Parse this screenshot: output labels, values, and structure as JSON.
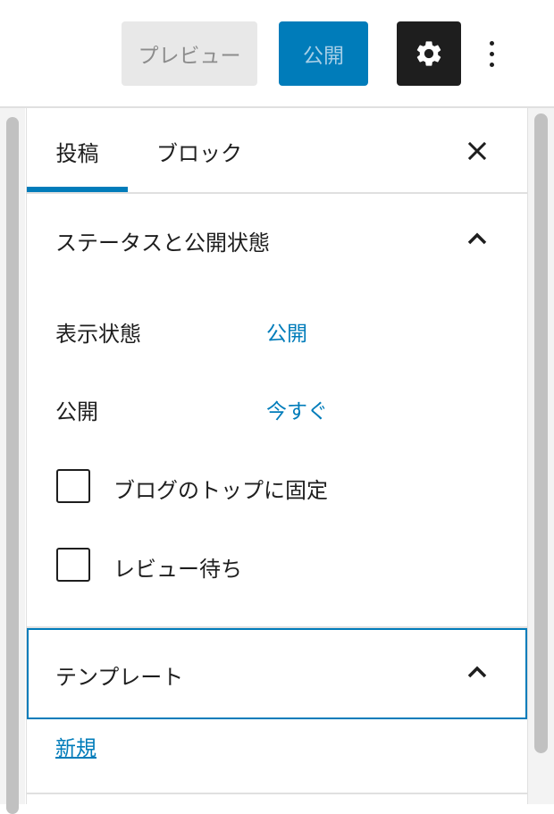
{
  "toolbar": {
    "preview_label": "プレビュー",
    "publish_label": "公開",
    "settings_icon": "gear-icon",
    "more_icon": "vertical-ellipsis-icon"
  },
  "sidebar": {
    "tabs": [
      {
        "label": "投稿",
        "active": true
      },
      {
        "label": "ブロック",
        "active": false
      }
    ],
    "close_icon": "close-icon",
    "status_section": {
      "title": "ステータスと公開状態",
      "expanded": true,
      "rows": [
        {
          "label": "表示状態",
          "value": "公開"
        },
        {
          "label": "公開",
          "value": "今すぐ"
        }
      ],
      "checkboxes": [
        {
          "label": "ブログのトップに固定",
          "checked": false
        },
        {
          "label": "レビュー待ち",
          "checked": false
        }
      ]
    },
    "template_section": {
      "title": "テンプレート",
      "expanded": true,
      "link_label": "新規"
    }
  },
  "colors": {
    "accent": "#007cba",
    "dark": "#1e1e1e",
    "preview_bg": "#e8e8e8",
    "border": "#e0e0e0"
  }
}
